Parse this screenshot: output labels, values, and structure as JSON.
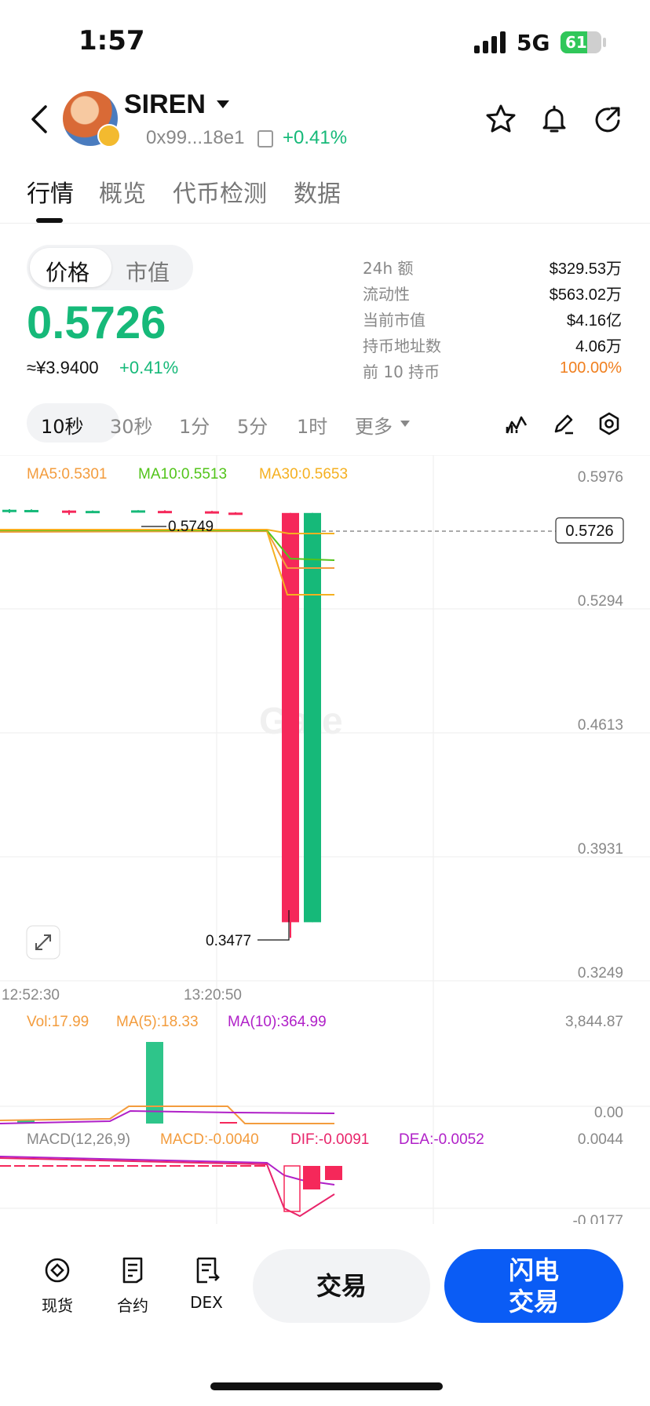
{
  "status_bar": {
    "time": "1:57",
    "network": "5G",
    "battery": "61"
  },
  "header": {
    "token_name": "SIREN",
    "address": "0x99...18e1",
    "change": "+0.41%",
    "icons": [
      "back-icon",
      "star-icon",
      "bell-icon",
      "share-icon"
    ]
  },
  "tabs": [
    "行情",
    "概览",
    "代币检测",
    "数据"
  ],
  "price_panel": {
    "toggle": [
      "价格",
      "市值"
    ],
    "price": "0.5726",
    "cny": "≈¥3.9400",
    "change": "+0.41%",
    "stats": [
      {
        "label": "24h  额",
        "value": "$329.53万"
      },
      {
        "label": "流动性",
        "value": "$563.02万"
      },
      {
        "label": "当前市值",
        "value": "$4.16亿"
      },
      {
        "label": "持币地址数",
        "value": "4.06万"
      },
      {
        "label": "前 10 持币",
        "value": "100.00%"
      }
    ]
  },
  "intervals": [
    "10秒",
    "30秒",
    "1分",
    "5分",
    "1时",
    "更多"
  ],
  "chart_data": {
    "type": "candlestick",
    "price_axis": [
      "0.5976",
      "0.5294",
      "0.4613",
      "0.3931",
      "0.3249"
    ],
    "current_price_label": "0.5726",
    "high_marker": "0.5749",
    "low_marker": "0.3477",
    "x_labels": [
      "12:52:30",
      "13:20:50"
    ],
    "ma_legend": [
      {
        "name": "MA5",
        "value": "MA5:0.5301",
        "color": "#f39c3d"
      },
      {
        "name": "MA10",
        "value": "MA10:0.5513",
        "color": "#52c41a"
      },
      {
        "name": "MA30",
        "value": "MA30:0.5653",
        "color": "#f5b020"
      }
    ],
    "candles": [
      {
        "open": 0.574,
        "close": 0.5752,
        "high": 0.5755,
        "low": 0.5735
      },
      {
        "open": 0.5745,
        "close": 0.5751,
        "high": 0.5754,
        "low": 0.5741
      },
      {
        "open": 0.5748,
        "close": 0.5742,
        "high": 0.575,
        "low": 0.5725
      },
      {
        "open": 0.5742,
        "close": 0.5746,
        "high": 0.5748,
        "low": 0.574
      },
      {
        "open": 0.5744,
        "close": 0.5749,
        "high": 0.575,
        "low": 0.5742
      },
      {
        "open": 0.5746,
        "close": 0.5744,
        "high": 0.5749,
        "low": 0.5741
      },
      {
        "open": 0.5744,
        "close": 0.5737,
        "high": 0.5746,
        "low": 0.5734
      },
      {
        "open": 0.5737,
        "close": 0.5733,
        "high": 0.5739,
        "low": 0.573
      },
      {
        "open": 0.5735,
        "close": 0.356,
        "high": 0.5735,
        "low": 0.3477
      },
      {
        "open": 0.356,
        "close": 0.5735,
        "high": 0.5735,
        "low": 0.356
      }
    ],
    "volume": {
      "legend": [
        {
          "label": "Vol:17.99",
          "color": "#f39c3d"
        },
        {
          "label": "MA(5):18.33",
          "color": "#f39c3d"
        },
        {
          "label": "MA(10):364.99",
          "color": "#b020c8"
        }
      ],
      "axis": [
        "3,844.87",
        "0.00"
      ],
      "bars": [
        180,
        0,
        0,
        0,
        3844.87,
        0,
        30,
        0,
        0,
        0
      ]
    },
    "macd": {
      "legend": [
        {
          "label": "MACD(12,26,9)",
          "color": "#888888"
        },
        {
          "label": "MACD:-0.0040",
          "color": "#f39c3d"
        },
        {
          "label": "DIF:-0.0091",
          "color": "#e8246a"
        },
        {
          "label": "DEA:-0.0052",
          "color": "#b020c8"
        }
      ],
      "axis_top": "0.0044",
      "axis_bottom": "-0.0177"
    },
    "watermark": "Gate"
  },
  "bottom_nav": {
    "items": [
      {
        "label": "现货",
        "icon": "spot-icon"
      },
      {
        "label": "合约",
        "icon": "contract-icon"
      },
      {
        "label": "DEX",
        "icon": "dex-icon"
      }
    ],
    "trade": "交易",
    "flash_trade": [
      "闪电",
      "交易"
    ]
  },
  "colors": {
    "up": "#16b979",
    "down": "#f5285a",
    "primary": "#0a5cf5"
  }
}
